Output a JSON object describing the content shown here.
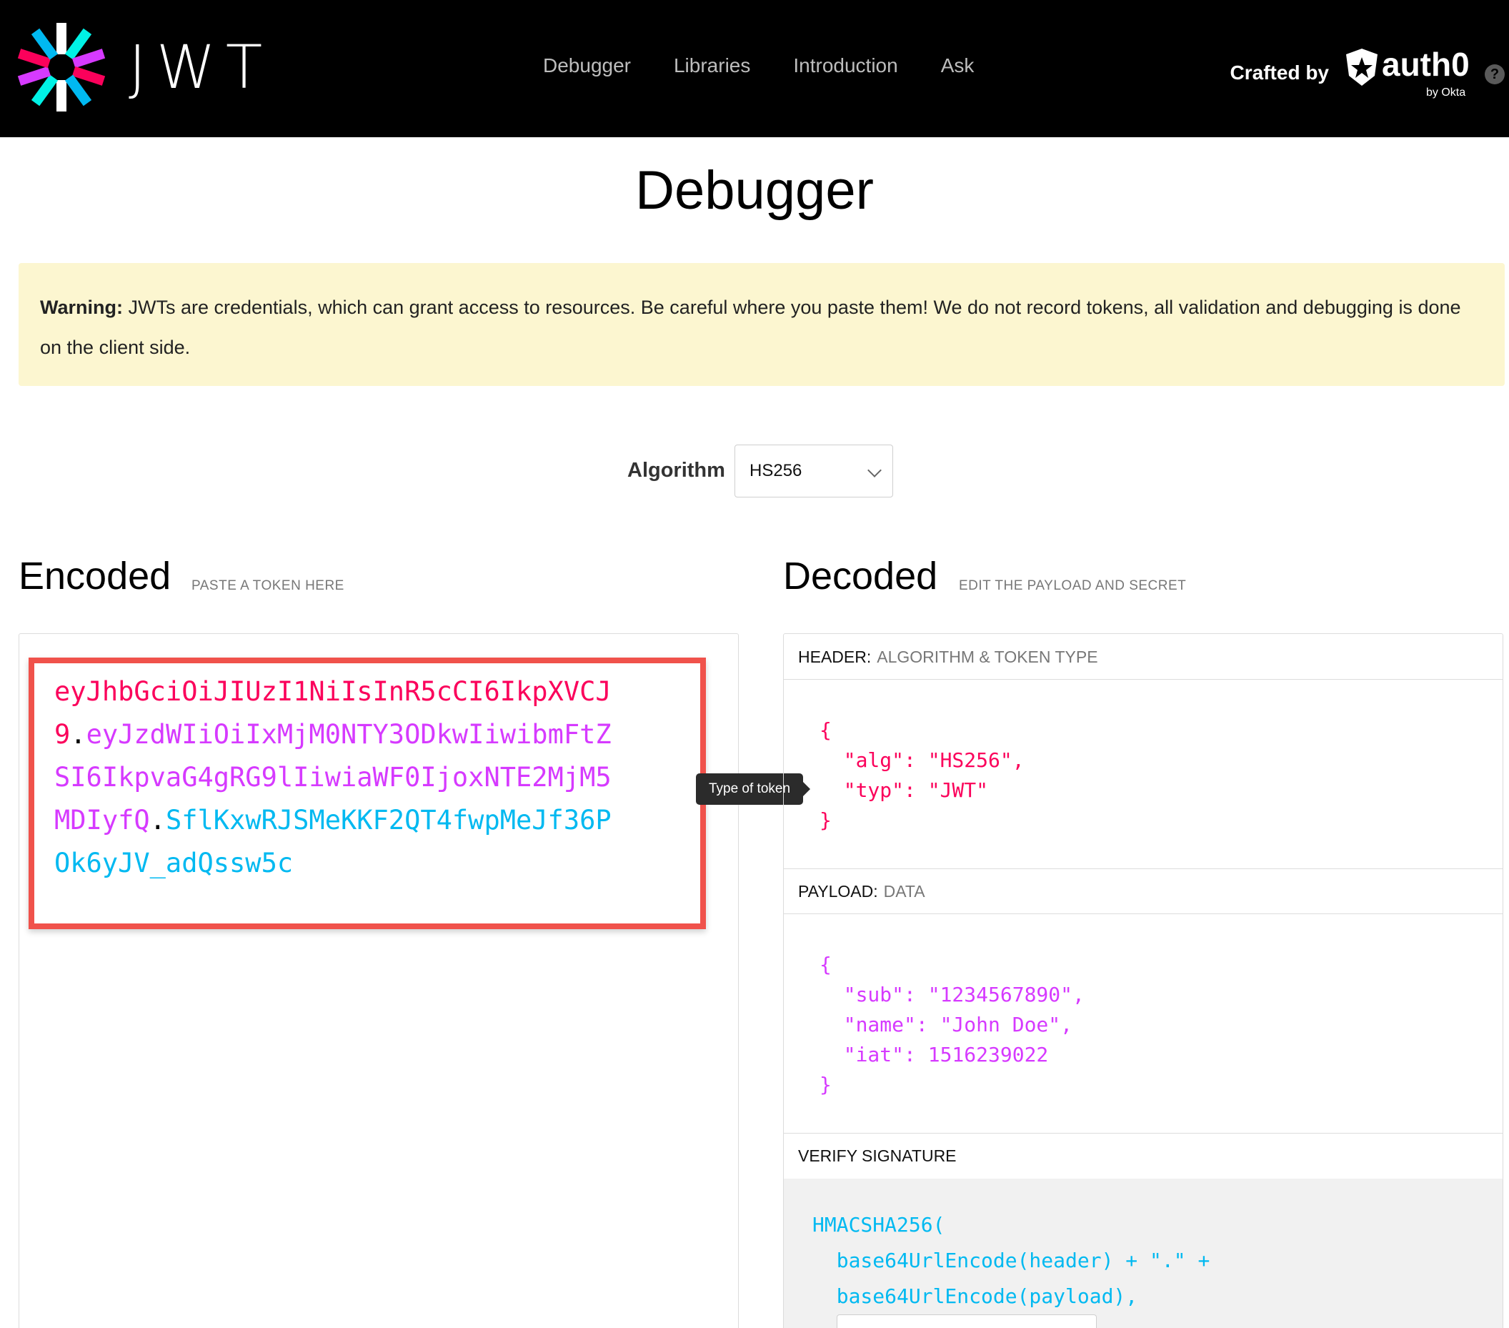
{
  "brand": {
    "wordmark": "JWT",
    "icon": "jwt-starburst-icon"
  },
  "nav": {
    "items": [
      {
        "label": "Debugger"
      },
      {
        "label": "Libraries"
      },
      {
        "label": "Introduction"
      },
      {
        "label": "Ask"
      }
    ]
  },
  "crafted": {
    "label": "Crafted by",
    "company": "auth0",
    "sub": "by Okta",
    "help": "?"
  },
  "page": {
    "title": "Debugger"
  },
  "warning": {
    "prefix": "Warning:",
    "text": " JWTs are credentials, which can grant access to resources. Be careful where you paste them! We do not record tokens, all validation and debugging is done on the client side."
  },
  "algorithm": {
    "label": "Algorithm",
    "selected": "HS256"
  },
  "encoded": {
    "title": "Encoded",
    "subtitle": "PASTE A TOKEN HERE",
    "token_header": "eyJhbGciOiJIUzI1NiIsInR5cCI6IkpXVCJ9",
    "token_payload": "eyJzdWIiOiIxMjM0NTY3ODkwIiwibmFtZSI6IkpvaG4gRG9lIiwiaWF0IjoxNTE2MjM5MDIyfQ",
    "token_signature": "SflKxwRJSMeKKF2QT4fwpMeJf36POk6yJV_adQssw5c",
    "dot": "."
  },
  "tooltip": {
    "text": "Type of token"
  },
  "decoded": {
    "title": "Decoded",
    "subtitle": "EDIT THE PAYLOAD AND SECRET",
    "header_label": "HEADER:",
    "header_desc": "ALGORITHM & TOKEN TYPE",
    "header_json": "{\n  \"alg\": \"HS256\",\n  \"typ\": \"JWT\"\n}",
    "payload_label": "PAYLOAD:",
    "payload_desc": "DATA",
    "payload_json": "{\n  \"sub\": \"1234567890\",\n  \"name\": \"John Doe\",\n  \"iat\": 1516239022\n}",
    "verify_label": "VERIFY SIGNATURE",
    "verify_code": "HMACSHA256(\n  base64UrlEncode(header) + \".\" +\n  base64UrlEncode(payload),"
  },
  "colors": {
    "header": "#fb015b",
    "payload": "#d63aff",
    "signature": "#00b9f1",
    "highlight": "#f0524b",
    "warning_bg": "#fcf6d0"
  }
}
